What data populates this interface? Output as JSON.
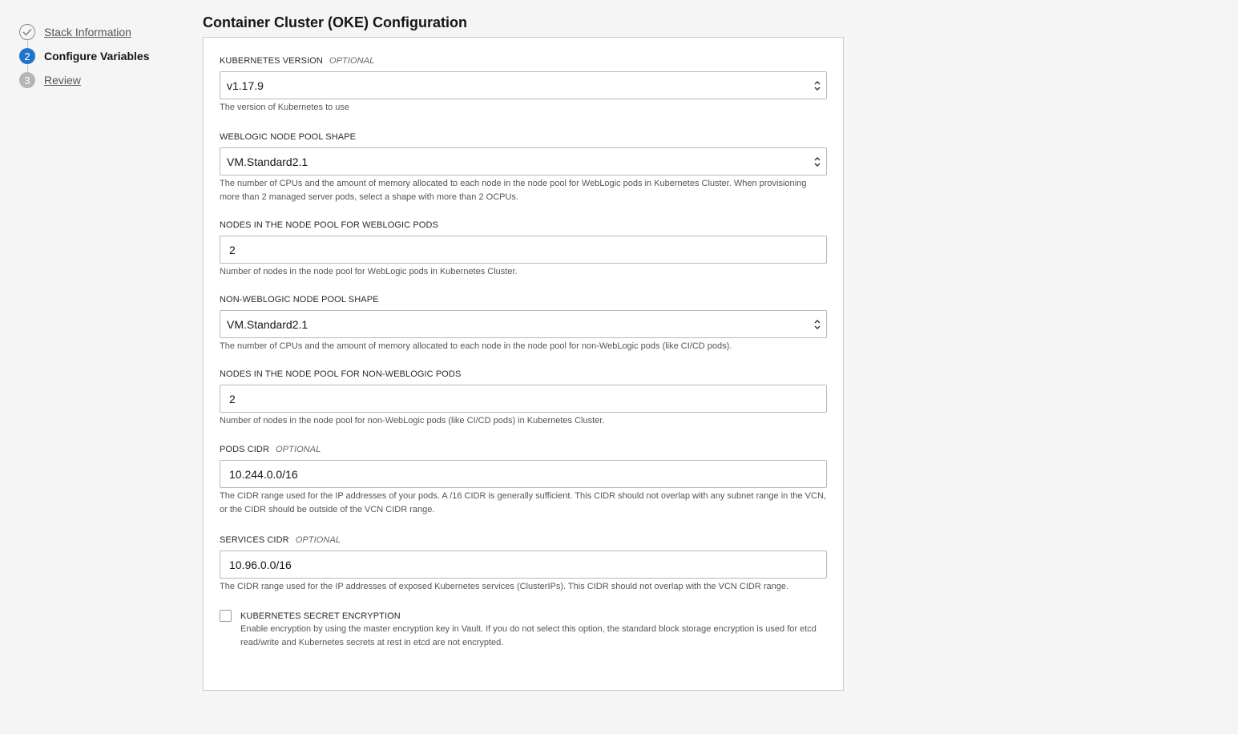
{
  "steps": [
    {
      "number": "✓",
      "label": "Stack Information",
      "state": "done"
    },
    {
      "number": "2",
      "label": "Configure Variables",
      "state": "active"
    },
    {
      "number": "3",
      "label": "Review",
      "state": "pending"
    }
  ],
  "section_title": "Container Cluster (OKE) Configuration",
  "fields": {
    "k8s_version": {
      "label": "KUBERNETES VERSION",
      "optional": "OPTIONAL",
      "value": "v1.17.9",
      "help": "The version of Kubernetes to use"
    },
    "wls_shape": {
      "label": "WEBLOGIC NODE POOL SHAPE",
      "value": "VM.Standard2.1",
      "help": "The number of CPUs and the amount of memory allocated to each node in the node pool for WebLogic pods in Kubernetes Cluster. When provisioning more than 2 managed server pods, select a shape with more than 2 OCPUs."
    },
    "wls_nodes": {
      "label": "NODES IN THE NODE POOL FOR WEBLOGIC PODS",
      "value": "2",
      "help": "Number of nodes in the node pool for WebLogic pods in Kubernetes Cluster."
    },
    "nonwls_shape": {
      "label": "NON-WEBLOGIC NODE POOL SHAPE",
      "value": "VM.Standard2.1",
      "help": "The number of CPUs and the amount of memory allocated to each node in the node pool for non-WebLogic pods (like CI/CD pods)."
    },
    "nonwls_nodes": {
      "label": "NODES IN THE NODE POOL FOR NON-WEBLOGIC PODS",
      "value": "2",
      "help": "Number of nodes in the node pool for non-WebLogic pods (like CI/CD pods) in Kubernetes Cluster."
    },
    "pods_cidr": {
      "label": "PODS CIDR",
      "optional": "OPTIONAL",
      "value": "10.244.0.0/16",
      "help": "The CIDR range used for the IP addresses of your pods. A /16 CIDR is generally sufficient. This CIDR should not overlap with any subnet range in the VCN, or the CIDR should be outside of the VCN CIDR range."
    },
    "services_cidr": {
      "label": "SERVICES CIDR",
      "optional": "OPTIONAL",
      "value": "10.96.0.0/16",
      "help": "The CIDR range used for the IP addresses of exposed Kubernetes services (ClusterIPs). This CIDR should not overlap with the VCN CIDR range."
    },
    "secret_encryption": {
      "label": "KUBERNETES SECRET ENCRYPTION",
      "checked": false,
      "help": "Enable encryption by using the master encryption key in Vault. If you do not select this option, the standard block storage encryption is used for etcd read/write and Kubernetes secrets at rest in etcd are not encrypted."
    }
  },
  "colors": {
    "accent": "#2274c9",
    "background": "#f5f5f5",
    "panel": "#ffffff"
  }
}
